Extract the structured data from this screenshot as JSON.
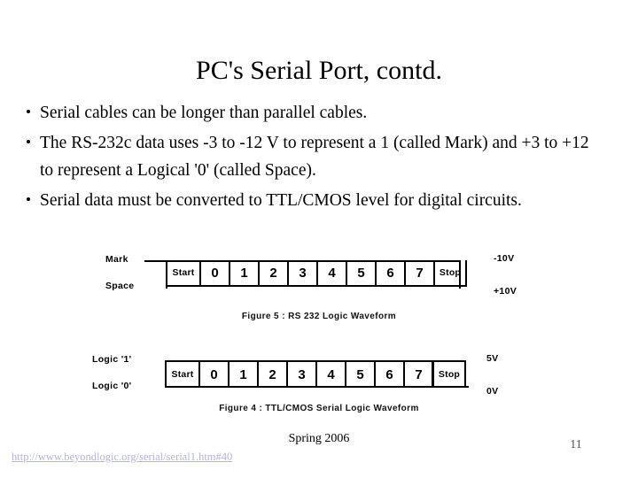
{
  "slide": {
    "title": "PC's Serial Port, contd.",
    "bullets": [
      "Serial cables can be longer than parallel cables.",
      "The RS-232c data uses -3 to -12 V to represent a 1 (called Mark) and +3 to +12 to represent a Logical '0' (called Space).",
      "Serial data must be converted to TTL/CMOS level for digital circuits."
    ]
  },
  "figures": [
    {
      "id": "figure5",
      "caption": "Figure 5 : RS 232 Logic Waveform",
      "left_label_top": "Mark",
      "left_label_bottom": "Space",
      "right_label_top": "-10V",
      "right_label_bottom": "+10V",
      "cells": [
        "Start",
        "0",
        "1",
        "2",
        "3",
        "4",
        "5",
        "6",
        "7",
        "Stop"
      ]
    },
    {
      "id": "figure4",
      "caption": "Figure 4 : TTL/CMOS Serial Logic Waveform",
      "left_label_top": "Logic '1'",
      "left_label_bottom": "Logic '0'",
      "right_label_top": "5V",
      "right_label_bottom": "0V",
      "cells": [
        "Start",
        "0",
        "1",
        "2",
        "3",
        "4",
        "5",
        "6",
        "7",
        "Stop"
      ]
    }
  ],
  "footer": {
    "date": "Spring 2006",
    "page_number": "11",
    "source_url": "http://www.beyondlogic.org/serial/serial1.htm#40"
  },
  "colors": {
    "ink": "#000000",
    "link": "#b3b3e6",
    "page_number": "#555555",
    "background": "#ffffff"
  }
}
